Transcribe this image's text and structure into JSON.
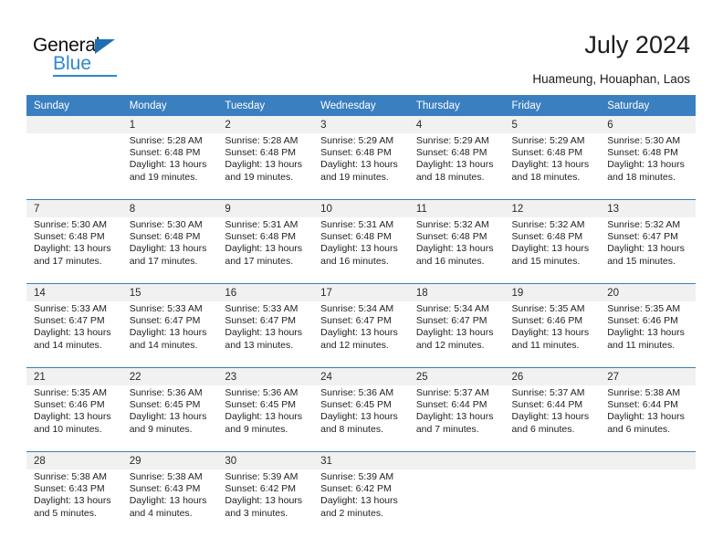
{
  "brand": {
    "name_top": "General",
    "name_bottom": "Blue",
    "accent_color": "#2e87d2",
    "triangle_color": "#1f6fb2"
  },
  "header": {
    "title": "July 2024",
    "subtitle": "Huameung, Houaphan, Laos"
  },
  "calendar": {
    "header_bg": "#3a7fc0",
    "daynum_bg": "#f1f1f1",
    "weekdays": [
      "Sunday",
      "Monday",
      "Tuesday",
      "Wednesday",
      "Thursday",
      "Friday",
      "Saturday"
    ],
    "weeks": [
      [
        {
          "day": "",
          "sunrise": "",
          "sunset": "",
          "daylight_line1": "",
          "daylight_line2": ""
        },
        {
          "day": "1",
          "sunrise": "Sunrise: 5:28 AM",
          "sunset": "Sunset: 6:48 PM",
          "daylight_line1": "Daylight: 13 hours",
          "daylight_line2": "and 19 minutes."
        },
        {
          "day": "2",
          "sunrise": "Sunrise: 5:28 AM",
          "sunset": "Sunset: 6:48 PM",
          "daylight_line1": "Daylight: 13 hours",
          "daylight_line2": "and 19 minutes."
        },
        {
          "day": "3",
          "sunrise": "Sunrise: 5:29 AM",
          "sunset": "Sunset: 6:48 PM",
          "daylight_line1": "Daylight: 13 hours",
          "daylight_line2": "and 19 minutes."
        },
        {
          "day": "4",
          "sunrise": "Sunrise: 5:29 AM",
          "sunset": "Sunset: 6:48 PM",
          "daylight_line1": "Daylight: 13 hours",
          "daylight_line2": "and 18 minutes."
        },
        {
          "day": "5",
          "sunrise": "Sunrise: 5:29 AM",
          "sunset": "Sunset: 6:48 PM",
          "daylight_line1": "Daylight: 13 hours",
          "daylight_line2": "and 18 minutes."
        },
        {
          "day": "6",
          "sunrise": "Sunrise: 5:30 AM",
          "sunset": "Sunset: 6:48 PM",
          "daylight_line1": "Daylight: 13 hours",
          "daylight_line2": "and 18 minutes."
        }
      ],
      [
        {
          "day": "7",
          "sunrise": "Sunrise: 5:30 AM",
          "sunset": "Sunset: 6:48 PM",
          "daylight_line1": "Daylight: 13 hours",
          "daylight_line2": "and 17 minutes."
        },
        {
          "day": "8",
          "sunrise": "Sunrise: 5:30 AM",
          "sunset": "Sunset: 6:48 PM",
          "daylight_line1": "Daylight: 13 hours",
          "daylight_line2": "and 17 minutes."
        },
        {
          "day": "9",
          "sunrise": "Sunrise: 5:31 AM",
          "sunset": "Sunset: 6:48 PM",
          "daylight_line1": "Daylight: 13 hours",
          "daylight_line2": "and 17 minutes."
        },
        {
          "day": "10",
          "sunrise": "Sunrise: 5:31 AM",
          "sunset": "Sunset: 6:48 PM",
          "daylight_line1": "Daylight: 13 hours",
          "daylight_line2": "and 16 minutes."
        },
        {
          "day": "11",
          "sunrise": "Sunrise: 5:32 AM",
          "sunset": "Sunset: 6:48 PM",
          "daylight_line1": "Daylight: 13 hours",
          "daylight_line2": "and 16 minutes."
        },
        {
          "day": "12",
          "sunrise": "Sunrise: 5:32 AM",
          "sunset": "Sunset: 6:48 PM",
          "daylight_line1": "Daylight: 13 hours",
          "daylight_line2": "and 15 minutes."
        },
        {
          "day": "13",
          "sunrise": "Sunrise: 5:32 AM",
          "sunset": "Sunset: 6:47 PM",
          "daylight_line1": "Daylight: 13 hours",
          "daylight_line2": "and 15 minutes."
        }
      ],
      [
        {
          "day": "14",
          "sunrise": "Sunrise: 5:33 AM",
          "sunset": "Sunset: 6:47 PM",
          "daylight_line1": "Daylight: 13 hours",
          "daylight_line2": "and 14 minutes."
        },
        {
          "day": "15",
          "sunrise": "Sunrise: 5:33 AM",
          "sunset": "Sunset: 6:47 PM",
          "daylight_line1": "Daylight: 13 hours",
          "daylight_line2": "and 14 minutes."
        },
        {
          "day": "16",
          "sunrise": "Sunrise: 5:33 AM",
          "sunset": "Sunset: 6:47 PM",
          "daylight_line1": "Daylight: 13 hours",
          "daylight_line2": "and 13 minutes."
        },
        {
          "day": "17",
          "sunrise": "Sunrise: 5:34 AM",
          "sunset": "Sunset: 6:47 PM",
          "daylight_line1": "Daylight: 13 hours",
          "daylight_line2": "and 12 minutes."
        },
        {
          "day": "18",
          "sunrise": "Sunrise: 5:34 AM",
          "sunset": "Sunset: 6:47 PM",
          "daylight_line1": "Daylight: 13 hours",
          "daylight_line2": "and 12 minutes."
        },
        {
          "day": "19",
          "sunrise": "Sunrise: 5:35 AM",
          "sunset": "Sunset: 6:46 PM",
          "daylight_line1": "Daylight: 13 hours",
          "daylight_line2": "and 11 minutes."
        },
        {
          "day": "20",
          "sunrise": "Sunrise: 5:35 AM",
          "sunset": "Sunset: 6:46 PM",
          "daylight_line1": "Daylight: 13 hours",
          "daylight_line2": "and 11 minutes."
        }
      ],
      [
        {
          "day": "21",
          "sunrise": "Sunrise: 5:35 AM",
          "sunset": "Sunset: 6:46 PM",
          "daylight_line1": "Daylight: 13 hours",
          "daylight_line2": "and 10 minutes."
        },
        {
          "day": "22",
          "sunrise": "Sunrise: 5:36 AM",
          "sunset": "Sunset: 6:45 PM",
          "daylight_line1": "Daylight: 13 hours",
          "daylight_line2": "and 9 minutes."
        },
        {
          "day": "23",
          "sunrise": "Sunrise: 5:36 AM",
          "sunset": "Sunset: 6:45 PM",
          "daylight_line1": "Daylight: 13 hours",
          "daylight_line2": "and 9 minutes."
        },
        {
          "day": "24",
          "sunrise": "Sunrise: 5:36 AM",
          "sunset": "Sunset: 6:45 PM",
          "daylight_line1": "Daylight: 13 hours",
          "daylight_line2": "and 8 minutes."
        },
        {
          "day": "25",
          "sunrise": "Sunrise: 5:37 AM",
          "sunset": "Sunset: 6:44 PM",
          "daylight_line1": "Daylight: 13 hours",
          "daylight_line2": "and 7 minutes."
        },
        {
          "day": "26",
          "sunrise": "Sunrise: 5:37 AM",
          "sunset": "Sunset: 6:44 PM",
          "daylight_line1": "Daylight: 13 hours",
          "daylight_line2": "and 6 minutes."
        },
        {
          "day": "27",
          "sunrise": "Sunrise: 5:38 AM",
          "sunset": "Sunset: 6:44 PM",
          "daylight_line1": "Daylight: 13 hours",
          "daylight_line2": "and 6 minutes."
        }
      ],
      [
        {
          "day": "28",
          "sunrise": "Sunrise: 5:38 AM",
          "sunset": "Sunset: 6:43 PM",
          "daylight_line1": "Daylight: 13 hours",
          "daylight_line2": "and 5 minutes."
        },
        {
          "day": "29",
          "sunrise": "Sunrise: 5:38 AM",
          "sunset": "Sunset: 6:43 PM",
          "daylight_line1": "Daylight: 13 hours",
          "daylight_line2": "and 4 minutes."
        },
        {
          "day": "30",
          "sunrise": "Sunrise: 5:39 AM",
          "sunset": "Sunset: 6:42 PM",
          "daylight_line1": "Daylight: 13 hours",
          "daylight_line2": "and 3 minutes."
        },
        {
          "day": "31",
          "sunrise": "Sunrise: 5:39 AM",
          "sunset": "Sunset: 6:42 PM",
          "daylight_line1": "Daylight: 13 hours",
          "daylight_line2": "and 2 minutes."
        },
        {
          "day": "",
          "sunrise": "",
          "sunset": "",
          "daylight_line1": "",
          "daylight_line2": ""
        },
        {
          "day": "",
          "sunrise": "",
          "sunset": "",
          "daylight_line1": "",
          "daylight_line2": ""
        },
        {
          "day": "",
          "sunrise": "",
          "sunset": "",
          "daylight_line1": "",
          "daylight_line2": ""
        }
      ]
    ]
  }
}
